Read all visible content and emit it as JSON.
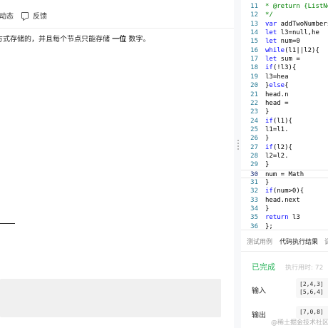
{
  "problem_panel": {
    "tab_dynamics": "动态",
    "tab_feedback": "反馈",
    "description_before": "方式存储的，并且每个节点只能存储 ",
    "description_bold": "一位",
    "description_after": " 数字。"
  },
  "editor": {
    "lines": [
      {
        "num": "11",
        "text": " * @return {ListNo"
      },
      {
        "num": "12",
        "text": " */"
      },
      {
        "num": "13",
        "text": "var addTwoNumbers"
      },
      {
        "num": "14",
        "text": "    let l3=null,he"
      },
      {
        "num": "15",
        "text": "    let num=0"
      },
      {
        "num": "16",
        "text": "    while(l1||l2){"
      },
      {
        "num": "17",
        "text": "        let sum ="
      },
      {
        "num": "18",
        "text": "        if(!l3){"
      },
      {
        "num": "19",
        "text": "            l3=hea"
      },
      {
        "num": "20",
        "text": "        }else{"
      },
      {
        "num": "21",
        "text": "            head.n"
      },
      {
        "num": "22",
        "text": "            head ="
      },
      {
        "num": "23",
        "text": "        }"
      },
      {
        "num": "24",
        "text": "        if(l1){"
      },
      {
        "num": "25",
        "text": "            l1=l1."
      },
      {
        "num": "26",
        "text": "        }"
      },
      {
        "num": "27",
        "text": "         if(l2){"
      },
      {
        "num": "28",
        "text": "            l2=l2."
      },
      {
        "num": "29",
        "text": "        }"
      },
      {
        "num": "30",
        "text": "        num = Math"
      },
      {
        "num": "31",
        "text": "    }"
      },
      {
        "num": "32",
        "text": "    if(num>0){"
      },
      {
        "num": "33",
        "text": "        head.next"
      },
      {
        "num": "34",
        "text": "    }"
      },
      {
        "num": "35",
        "text": "    return l3"
      },
      {
        "num": "36",
        "text": "};"
      }
    ]
  },
  "result_panel": {
    "tab_cases": "测试用例",
    "tab_result": "代码执行结果",
    "tab_more": "调",
    "status": "已完成",
    "exec_time": "执行用时: 72",
    "input_label": "输入",
    "input_lines": [
      "[2,4,3]",
      "[5,6,4]"
    ],
    "output_label": "输出",
    "output_value": "[7,0,8]"
  },
  "watermark": "@稀土掘金技术社区",
  "colors": {
    "success": "#2db55d",
    "line_number": "#237893",
    "keyword": "#0000ff",
    "comment": "#008000"
  }
}
